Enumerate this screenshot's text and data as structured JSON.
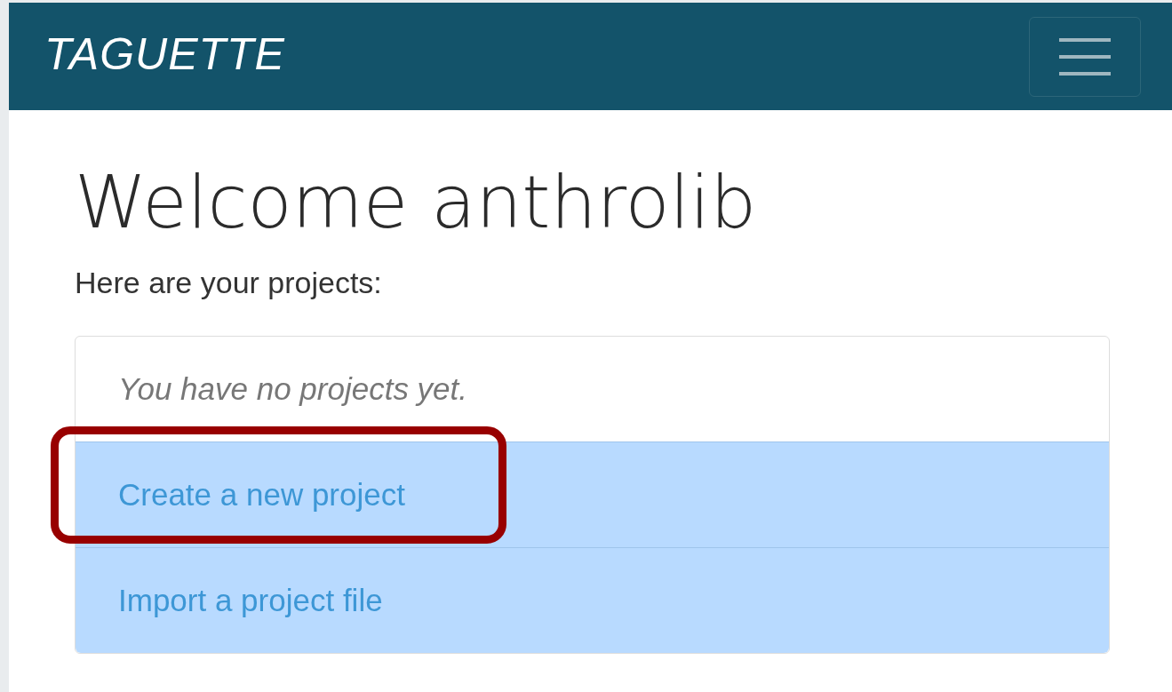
{
  "navbar": {
    "brand": "TAGUETTE"
  },
  "heading": "Welcome anthrolib",
  "intro": "Here are your projects:",
  "projects": [
    {
      "kind": "empty",
      "label": "You have no projects yet.",
      "highlighted": false
    },
    {
      "kind": "action",
      "label": "Create a new project",
      "highlighted": true
    },
    {
      "kind": "action",
      "label": "Import a project file",
      "highlighted": false
    }
  ]
}
